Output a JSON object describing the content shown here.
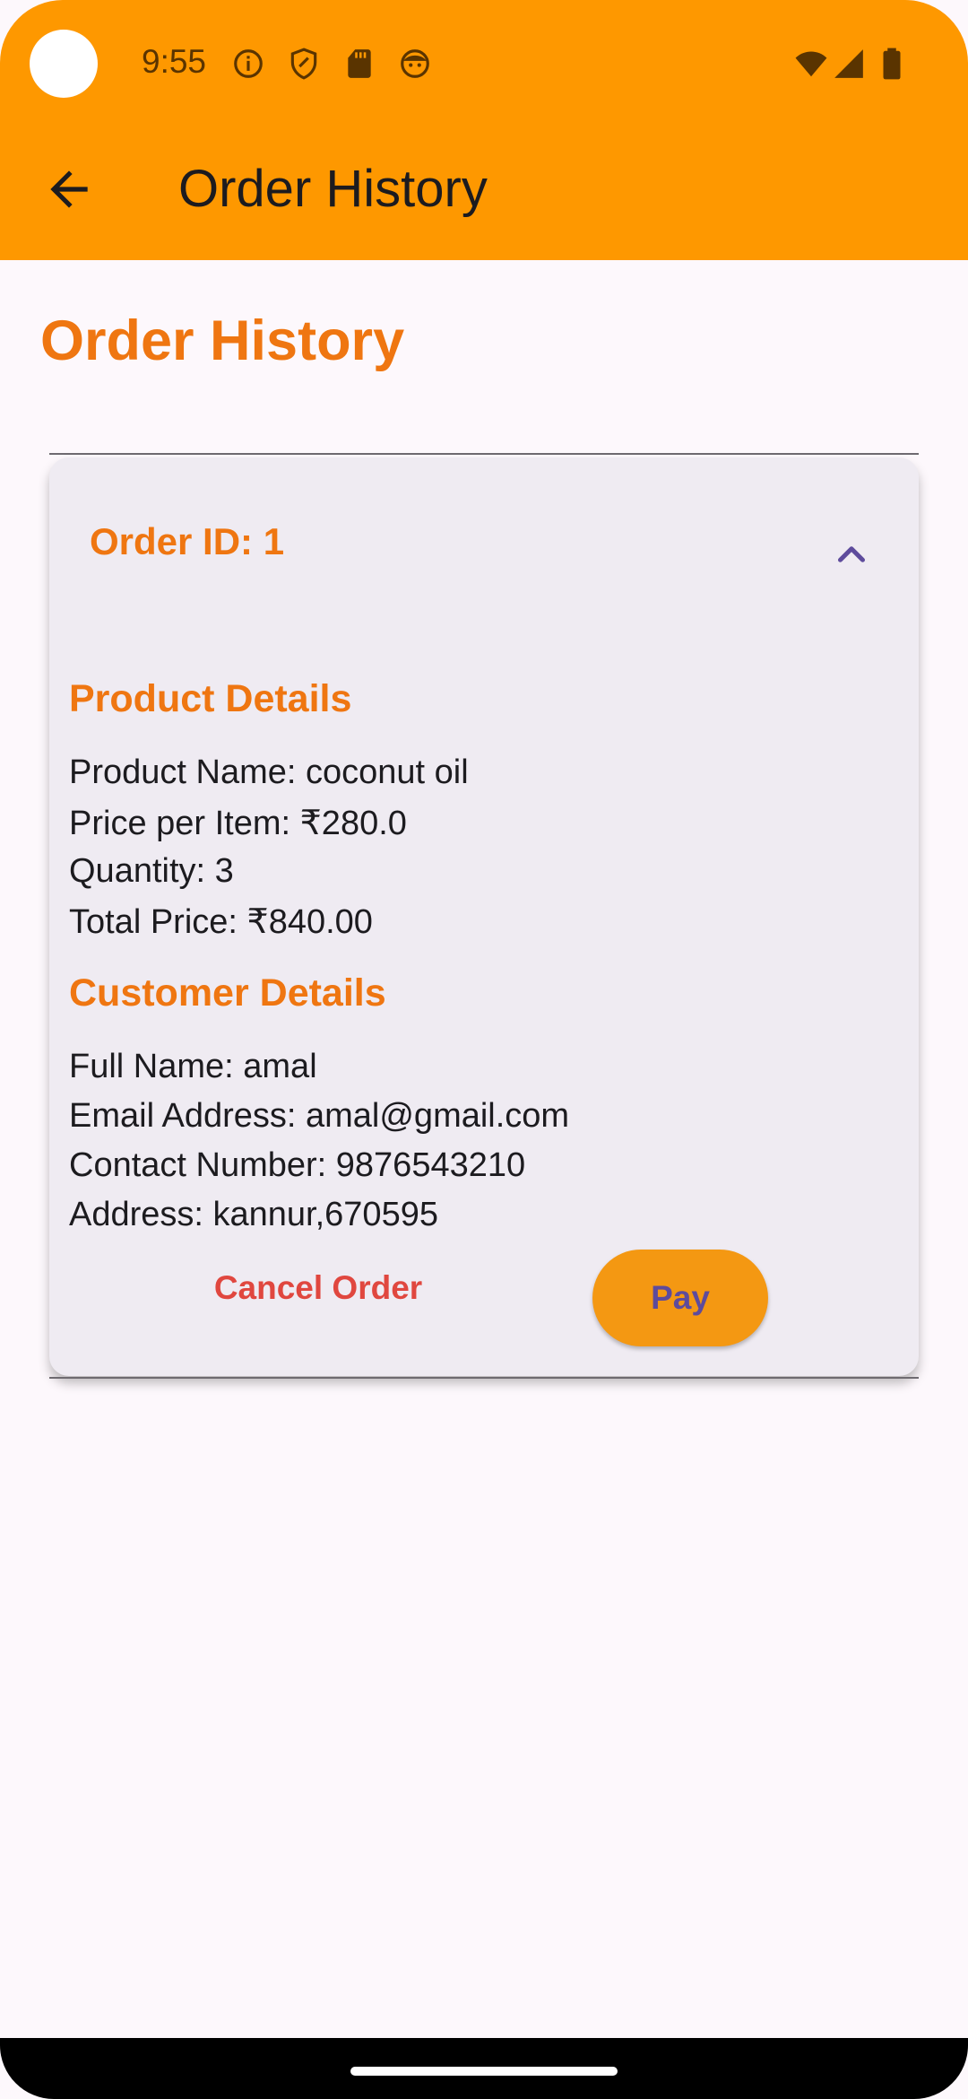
{
  "status_bar": {
    "time": "9:55",
    "left_icons": [
      "info-icon",
      "shield-icon",
      "sd-card-icon",
      "face-icon"
    ],
    "right_icons": [
      "wifi-icon",
      "signal-icon",
      "battery-icon"
    ]
  },
  "app_bar": {
    "back_icon": "arrow-back-icon",
    "title": "Order History"
  },
  "page": {
    "heading": "Order History"
  },
  "order": {
    "id_label": "Order ID: 1",
    "expanded": true,
    "product_section_title": "Product Details",
    "product_lines": [
      "Product Name: coconut oil",
      "Price per Item: ₹280.0",
      "Quantity: 3",
      "Total Price: ₹840.00"
    ],
    "customer_section_title": "Customer Details",
    "customer_lines": [
      "Full Name: amal",
      "Email Address: amal@gmail.com",
      "Contact Number: 9876543210",
      "Address: kannur,670595"
    ],
    "cancel_label": "Cancel Order",
    "pay_label": "Pay"
  },
  "colors": {
    "app_bar": "#fe9800",
    "accent_orange": "#ef7611",
    "card_bg": "#efebf2",
    "cancel_red": "#e0473f",
    "pay_button": "#f49812",
    "pay_text": "#5e4b9c",
    "chevron": "#5e4b9c"
  }
}
